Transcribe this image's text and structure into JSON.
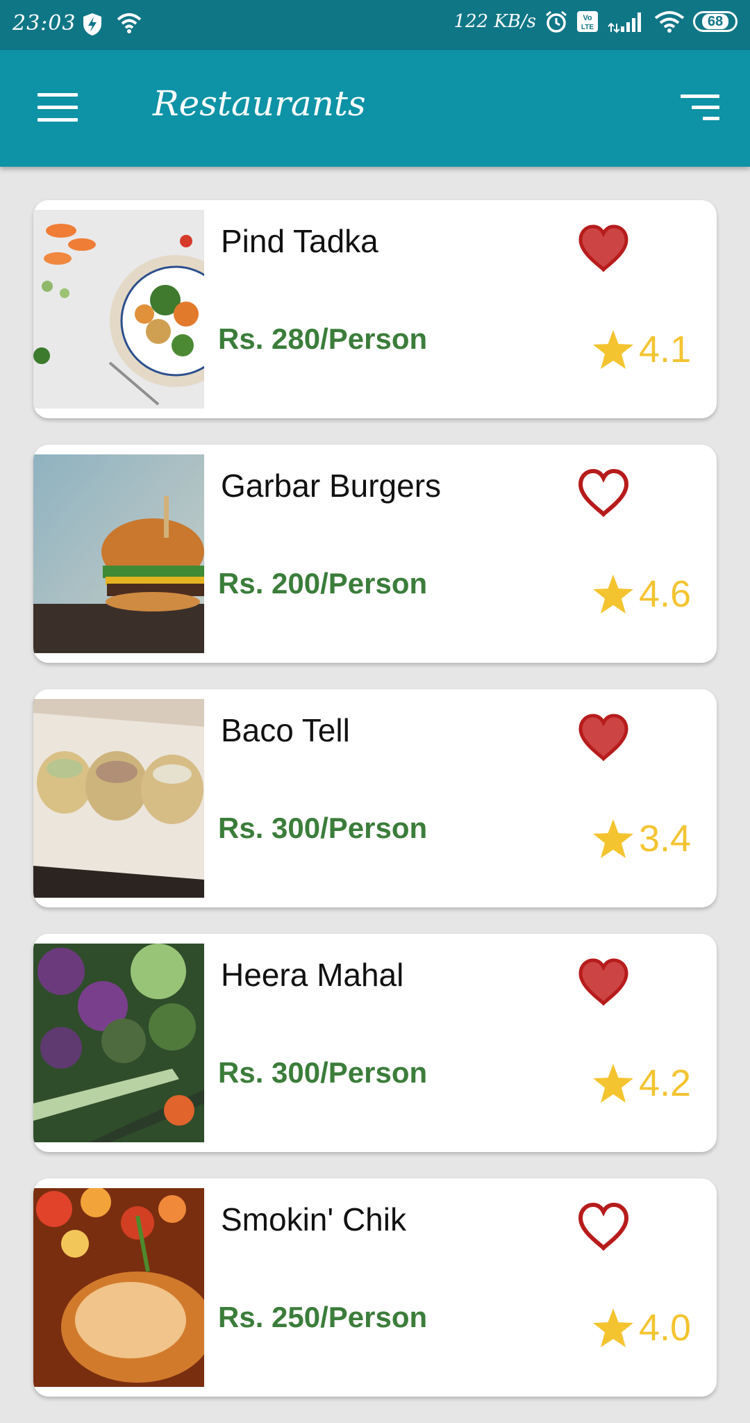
{
  "status_bar": {
    "time": "23:03",
    "net_speed": "122 KB/s",
    "battery": "68"
  },
  "app_bar": {
    "title": "Restaurants",
    "menu_icon": "hamburger-menu-icon",
    "sort_icon": "sort-icon"
  },
  "colors": {
    "app_bar": "#0e92a6",
    "status_bar": "#0f7686",
    "price": "#3b7d3a",
    "rating": "#f4c430",
    "heart": "#c62828"
  },
  "restaurants": [
    {
      "name": "Pind Tadka",
      "price": "Rs. 280/Person",
      "rating": "4.1",
      "favorite": true,
      "image": "vegetables-bowl"
    },
    {
      "name": "Garbar Burgers",
      "price": "Rs. 200/Person",
      "rating": "4.6",
      "favorite": false,
      "image": "burger"
    },
    {
      "name": "Baco Tell",
      "price": "Rs. 300/Person",
      "rating": "3.4",
      "favorite": true,
      "image": "tacos"
    },
    {
      "name": "Heera Mahal",
      "price": "Rs. 300/Person",
      "rating": "4.2",
      "favorite": true,
      "image": "vegetables"
    },
    {
      "name": "Smokin' Chik",
      "price": "Rs. 250/Person",
      "rating": "4.0",
      "favorite": false,
      "image": "roast-chicken"
    }
  ]
}
